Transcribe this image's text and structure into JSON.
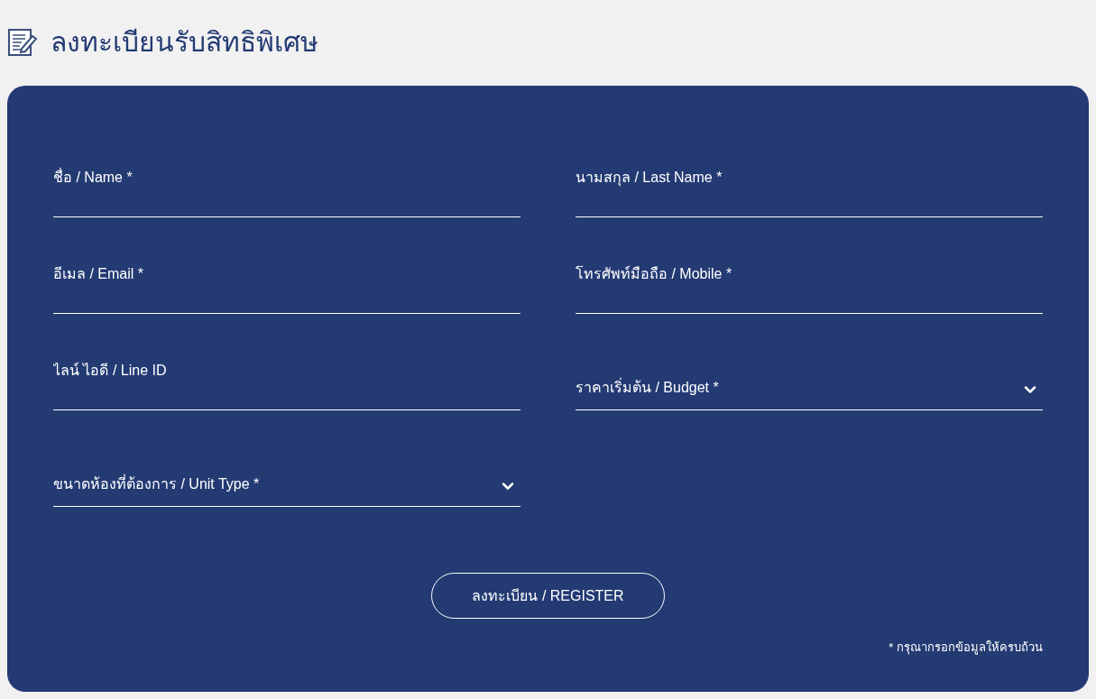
{
  "page_title": "ลงทะเบียนรับสิทธิพิเศษ",
  "fields": [
    {
      "kind": "text",
      "placeholder": "ชื่อ / Name *"
    },
    {
      "kind": "text",
      "placeholder": "นามสกุล / Last Name *"
    },
    {
      "kind": "text",
      "placeholder": "อีเมล / Email *"
    },
    {
      "kind": "text",
      "placeholder": "โทรศัพท์มือถือ / Mobile *"
    },
    {
      "kind": "text",
      "placeholder": "ไลน์ ไอดี / Line ID"
    },
    {
      "kind": "select",
      "placeholder": "ราคาเริ่มต้น / Budget *"
    },
    {
      "kind": "select",
      "placeholder": "ขนาดห้องที่ต้องการ / Unit Type *"
    }
  ],
  "submit_button": "ลงทะเบียน / REGISTER",
  "note": "* กรุณากรอกข้อมูลให้ครบถ้วน"
}
